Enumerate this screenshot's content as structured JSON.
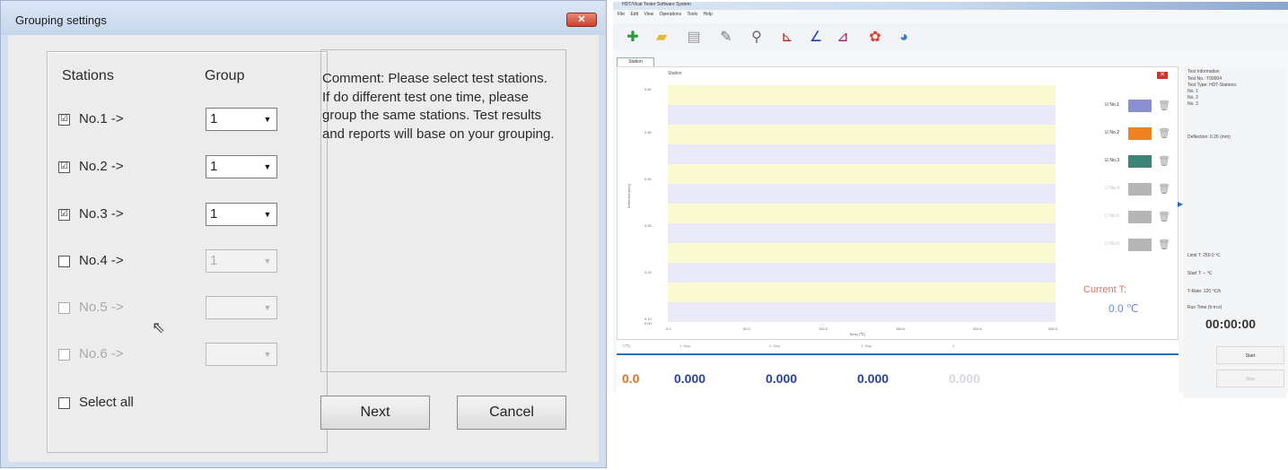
{
  "dialog": {
    "title": "Grouping settings",
    "close_label": "✕",
    "stations_header": "Stations",
    "group_header": "Group",
    "rows": [
      {
        "label": "No.1 ->",
        "checked": "☑",
        "group": "1",
        "enabled": true
      },
      {
        "label": "No.2 ->",
        "checked": "☑",
        "group": "1",
        "enabled": true
      },
      {
        "label": "No.3 ->",
        "checked": "☑",
        "group": "1",
        "enabled": true
      },
      {
        "label": "No.4 ->",
        "checked": "",
        "group": "1",
        "enabled": true
      },
      {
        "label": "No.5 ->",
        "checked": "",
        "group": "",
        "enabled": false
      },
      {
        "label": "No.6 ->",
        "checked": "",
        "group": "",
        "enabled": false
      }
    ],
    "select_all_label": "Select all",
    "comment": "Comment: Please select test stations. If do different test one time, please group the same stations. Test results and reports will base on your grouping.",
    "next_label": "Next",
    "cancel_label": "Cancel"
  },
  "app": {
    "title": "HDT/Vicat Tester Software System",
    "menu": [
      "File",
      "Edit",
      "View",
      "Operations",
      "Tools",
      "Help"
    ],
    "tab_label": "Station",
    "chart_title": "Station",
    "y_axis_label": "Deflection(mm)",
    "x_axis_label": "Temp.(℃)",
    "y_ticks": [
      "0.60",
      "0.50",
      "0.40",
      "0.30",
      "0.20",
      "0.10",
      "0.00"
    ],
    "x_ticks": [
      "0.0",
      "50.0",
      "100.0",
      "150.0",
      "200.0",
      "250.0"
    ],
    "legend": [
      {
        "label": "☑ No.1",
        "color": "#8a8fd0",
        "enabled": true
      },
      {
        "label": "☑ No.2",
        "color": "#ef8220",
        "enabled": true
      },
      {
        "label": "☑ No.3",
        "color": "#3e8376",
        "enabled": true
      },
      {
        "label": "☐ No.4",
        "color": "#b5b5b5",
        "enabled": false
      },
      {
        "label": "☐ No.5",
        "color": "#b5b5b5",
        "enabled": false
      },
      {
        "label": "☐ No.6",
        "color": "#b5b5b5",
        "enabled": false
      }
    ],
    "current_label": "Current T:",
    "current_value": "0.0 ℃",
    "info": {
      "header": "Test Information",
      "lines": [
        "Test No.: T00004",
        "Test Type: HDT-Stations:",
        "No. 1",
        "No. 2",
        "No. 3"
      ],
      "deflection": "Deflection: 0.26 (mm)",
      "limit": "Limit T: 250.0 ℃",
      "start": "Start T: -- ℃",
      "rate": "T-Rate: 120 ℃/h",
      "run_time_label": "Run Time (h:m:s)",
      "timer": "00:00:00",
      "start_button": "Start",
      "stop_button": "Stop"
    },
    "readouts": {
      "headers": [
        "T(℃)",
        "1. Disp",
        "2. Disp",
        "3. Disp",
        "4."
      ],
      "temp": "0.0",
      "values": [
        "0.000",
        "0.000",
        "0.000",
        "0.000"
      ]
    }
  }
}
